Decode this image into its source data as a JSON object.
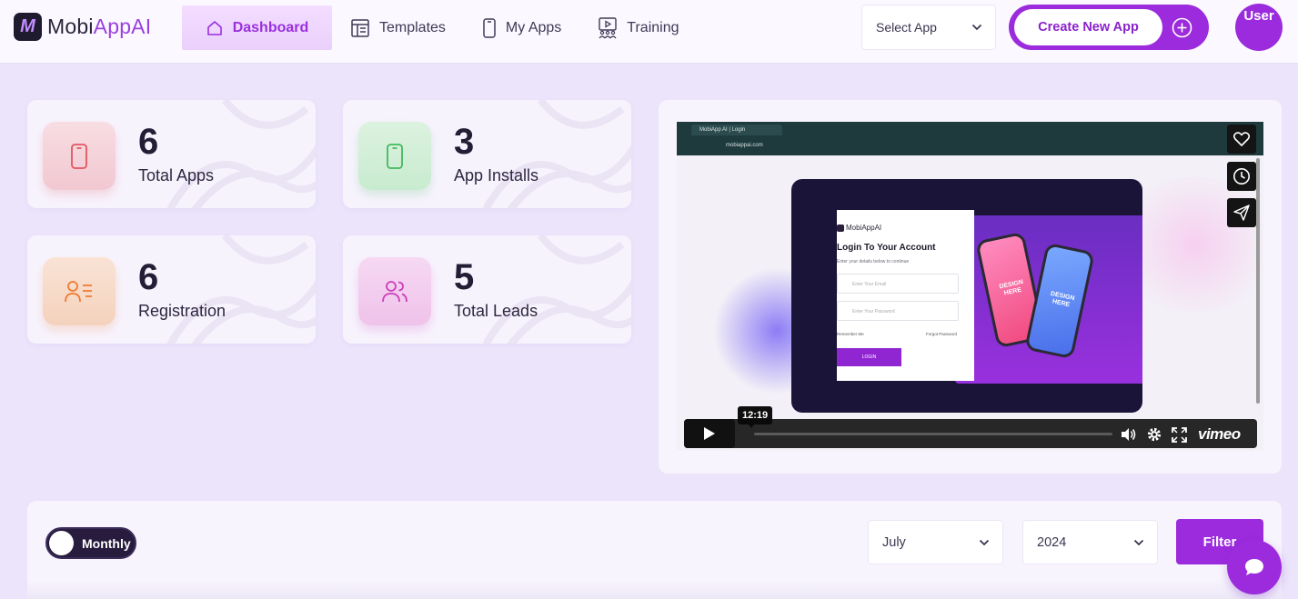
{
  "brand": {
    "name_part1": "Mobi",
    "name_part2": "AppAI",
    "icon": "mobiappai-logo-icon"
  },
  "nav": {
    "items": [
      {
        "label": "Dashboard",
        "icon": "home-icon",
        "active": true
      },
      {
        "label": "Templates",
        "icon": "templates-icon",
        "active": false
      },
      {
        "label": "My Apps",
        "icon": "smartphone-icon",
        "active": false
      },
      {
        "label": "Training",
        "icon": "training-icon",
        "active": false
      }
    ]
  },
  "header": {
    "select_app": {
      "value": "Select App",
      "icon": "chevron-down-icon"
    },
    "create_button": {
      "label": "Create New App",
      "icon": "plus-circle-icon"
    },
    "user": {
      "label": "User"
    }
  },
  "stats": [
    {
      "value": "6",
      "label": "Total Apps",
      "icon": "smartphone-icon",
      "color": "#e3545f",
      "bg": "#f5d6dc"
    },
    {
      "value": "3",
      "label": "App Installs",
      "icon": "smartphone-icon",
      "color": "#43b85c",
      "bg": "#d6f0db"
    },
    {
      "value": "6",
      "label": "Registration",
      "icon": "user-list-icon",
      "color": "#ef7a2f",
      "bg": "#f7dccb"
    },
    {
      "value": "5",
      "label": "Total Leads",
      "icon": "users-icon",
      "color": "#cc3fb8",
      "bg": "#f3cdf0"
    }
  ],
  "video": {
    "browser_tab": "MobiApp AI | Login",
    "url": "mobiappai.com",
    "login": {
      "brand": "MobiAppAI",
      "title": "Login To Your Account",
      "subtitle": "Enter your details below to continue",
      "email_placeholder": "Enter Your Email",
      "password_placeholder": "Enter Your Password",
      "remember": "Remember Me",
      "forgot": "Forgot Password",
      "button": "LOGIN"
    },
    "phone_text": "DESIGN HERE",
    "timestamp": "12:19",
    "player_brand": "vimeo",
    "side_icons": [
      "heart-icon",
      "clock-icon",
      "send-icon"
    ]
  },
  "filter": {
    "toggle_label": "Monthly",
    "month": "July",
    "year": "2024",
    "button": "Filter"
  },
  "chat": {
    "icon": "chat-icon"
  },
  "colors": {
    "accent": "#9b2bdc",
    "background": "#ebe4fb",
    "panel": "#f8f4fd"
  }
}
